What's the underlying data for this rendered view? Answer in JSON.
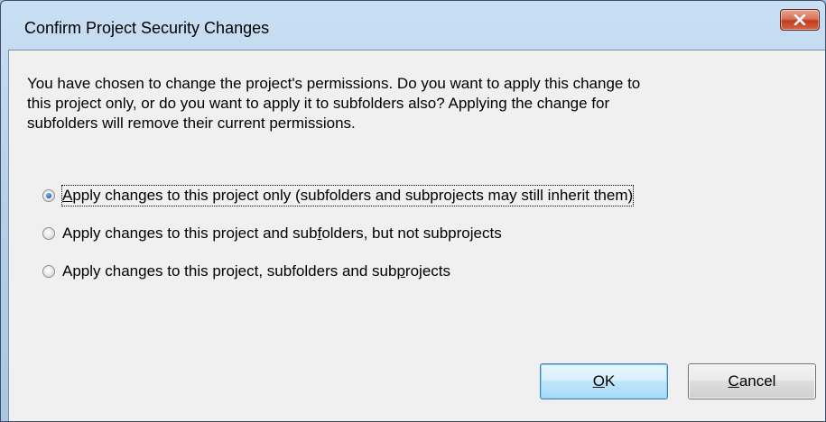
{
  "dialog": {
    "title": "Confirm Project Security Changes",
    "close_icon": "close-icon"
  },
  "message": {
    "lines": [
      "You have chosen to change the project's permissions. Do you want to apply this change to",
      "this project only, or do you want to apply it to subfolders also? Applying the change for",
      "subfolders will remove their current permissions."
    ]
  },
  "options": [
    {
      "label_before": "",
      "label_mnemonic": "A",
      "label_after": "pply changes to this project only (subfolders and subprojects may still inherit them)",
      "checked": true
    },
    {
      "label_before": "Apply changes to this project and sub",
      "label_mnemonic": "f",
      "label_after": "olders, but not subprojects",
      "checked": false
    },
    {
      "label_before": "Apply changes to this project, subfolders and sub",
      "label_mnemonic": "p",
      "label_after": "rojects",
      "checked": false
    }
  ],
  "buttons": {
    "ok_mnemonic": "O",
    "ok_rest": "K",
    "cancel_mnemonic": "C",
    "cancel_rest": "ancel"
  },
  "colors": {
    "frame": "#b9d2eb",
    "client": "#f0f0f0",
    "close_button": "#c23c1c",
    "default_button_border": "#3c7fb1",
    "radio_checked": "#1c5fb5"
  }
}
